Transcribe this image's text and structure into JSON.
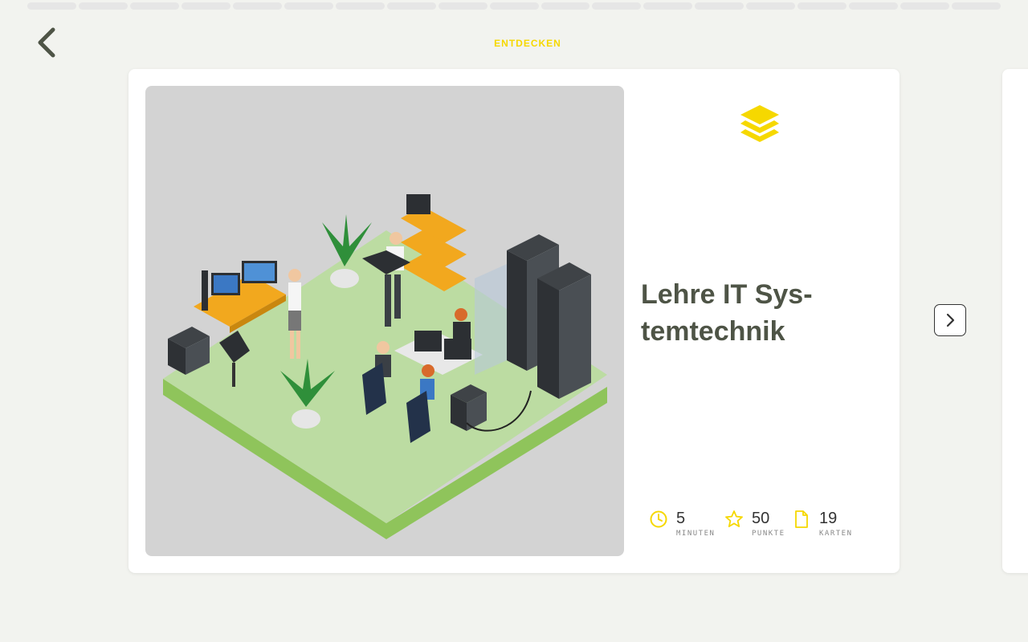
{
  "header": {
    "section_label": "ENTDECKEN",
    "progress_segments": 19
  },
  "card": {
    "title_line1": "Lehre IT Sys-",
    "title_line2": "temtechnik",
    "illustration_alt": "",
    "stats": [
      {
        "icon": "clock-icon",
        "value": "5",
        "label": "MINUTEN"
      },
      {
        "icon": "star-icon",
        "value": "50",
        "label": "PUNKTE"
      },
      {
        "icon": "document-icon",
        "value": "19",
        "label": "KARTEN"
      }
    ]
  },
  "colors": {
    "accent": "#f6d800",
    "background": "#f2f3ef",
    "title": "#4e5446",
    "icon_dark": "#4e5446"
  }
}
